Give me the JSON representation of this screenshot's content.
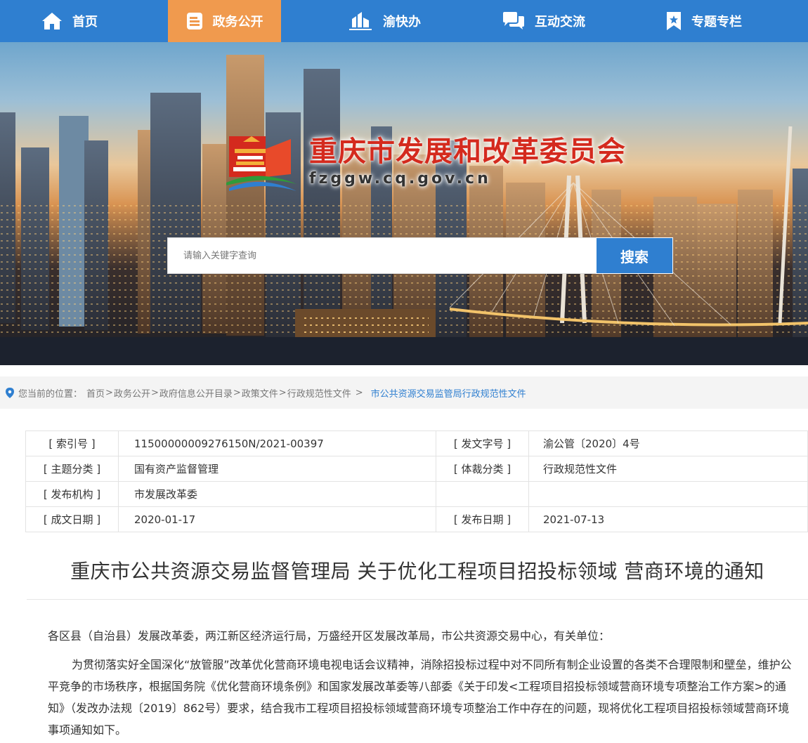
{
  "nav": {
    "items": [
      {
        "label": "首页",
        "icon": "home-icon"
      },
      {
        "label": "政务公开",
        "icon": "document-icon",
        "active": true
      },
      {
        "label": "渝快办",
        "icon": "building-icon"
      },
      {
        "label": "互动交流",
        "icon": "chat-icon"
      },
      {
        "label": "专题专栏",
        "icon": "bookmark-icon"
      }
    ]
  },
  "site": {
    "name": "重庆市发展和改革委员会",
    "domain": "fzggw.cq.gov.cn"
  },
  "search": {
    "placeholder": "请输入关键字查询",
    "button": "搜索"
  },
  "breadcrumb": {
    "prefix": "您当前的位置：",
    "items": [
      "首页",
      "政务公开",
      "政府信息公开目录",
      "政策文件",
      "行政规范性文件"
    ],
    "separator": ">",
    "current": "市公共资源交易监管局行政规范性文件"
  },
  "info": {
    "index_label": "[ 索引号 ]",
    "index_value": "11500000009276150N/2021-00397",
    "docno_label": "[ 发文字号 ]",
    "docno_value": "渝公管〔2020〕4号",
    "topic_label": "[ 主题分类 ]",
    "topic_value": "国有资产监督管理",
    "genre_label": "[ 体裁分类 ]",
    "genre_value": "行政规范性文件",
    "issuer_label": "[ 发布机构 ]",
    "issuer_value": "市发展改革委",
    "written_label": "[ 成文日期 ]",
    "written_value": "2020-01-17",
    "published_label": "[ 发布日期 ]",
    "published_value": "2021-07-13"
  },
  "article": {
    "title": "重庆市公共资源交易监督管理局 关于优化工程项目招投标领域 营商环境的通知",
    "salutation": "各区县（自治县）发展改革委，两江新区经济运行局，万盛经开区发展改革局，市公共资源交易中心，有关单位：",
    "paragraph1": "为贯彻落实好全国深化“放管服”改革优化营商环境电视电话会议精神，消除招投标过程中对不同所有制企业设置的各类不合理限制和壁垒，维护公平竞争的市场秩序，根据国务院《优化营商环境条例》和国家发展改革委等八部委《关于印发<工程项目招投标领域营商环境专项整治工作方案>的通知》（发改办法规〔2019〕862号）要求，结合我市工程项目招投标领域营商环境专项整治工作中存在的问题，现将优化工程项目招投标领域营商环境事项通知如下。"
  },
  "colors": {
    "nav_bg": "#2f7fd0",
    "nav_active": "#f09a4e",
    "logo_red": "#d42a1e",
    "link_blue": "#2f7fd0"
  }
}
